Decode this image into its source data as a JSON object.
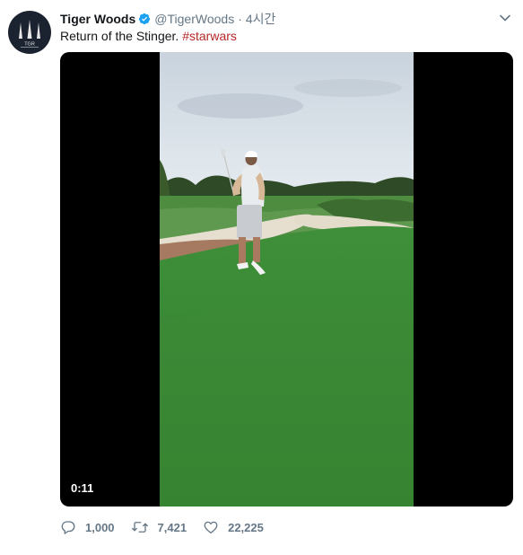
{
  "tweet": {
    "display_name": "Tiger Woods",
    "handle": "@TigerWoods",
    "separator": "·",
    "time": "4시간",
    "text": "Return of the Stinger.",
    "hashtag": "#starwars",
    "avatar_text": "TGR",
    "video_duration": "0:11",
    "replies": "1,000",
    "retweets": "7,421",
    "likes": "22,225"
  },
  "colors": {
    "hashtag": "#b62727",
    "verified": "#1da1f2",
    "muted": "#657786",
    "avatar_bg": "#1b2230"
  },
  "icons": {
    "verified": "verified-badge-icon",
    "more": "chevron-down-icon",
    "reply": "reply-icon",
    "retweet": "retweet-icon",
    "like": "heart-icon"
  }
}
